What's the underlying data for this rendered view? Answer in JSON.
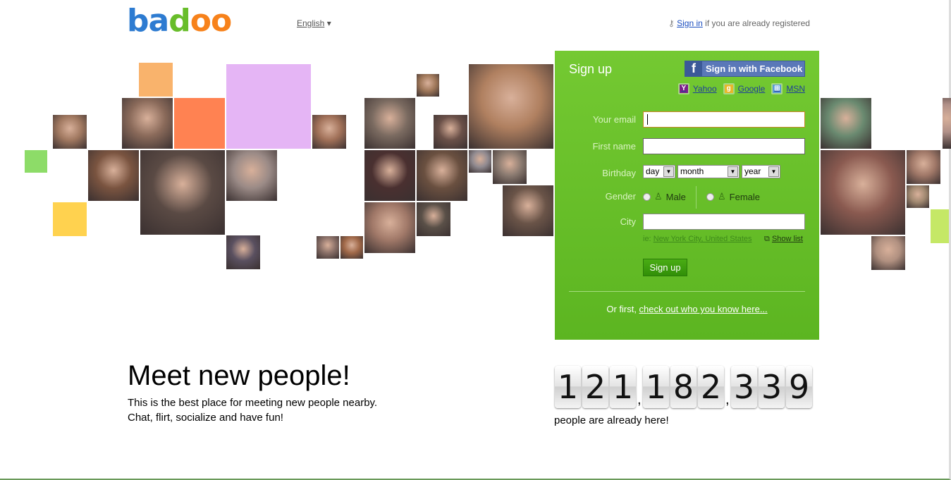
{
  "logo": {
    "b": "b",
    "a": "a",
    "d": "d",
    "o1": "o",
    "o2": "o"
  },
  "header": {
    "language": "English",
    "language_arrow": "▾",
    "signin_link": "Sign in",
    "signin_rest": " if you are already registered",
    "key_icon": "key-icon"
  },
  "signup": {
    "title": "Sign up",
    "facebook": "Sign in with Facebook",
    "providers": [
      {
        "label": "Yahoo",
        "icon": "Y",
        "color": "#7b1f8a"
      },
      {
        "label": "Google",
        "icon": "g",
        "color": "#e9b72a"
      },
      {
        "label": "MSN",
        "icon": "⊞",
        "color": "#5a9ad6"
      }
    ],
    "email_label": "Your email",
    "email_value": "",
    "firstname_label": "First name",
    "firstname_value": "",
    "birthday_label": "Birthday",
    "day": "day",
    "month": "month",
    "year": "year",
    "gender_label": "Gender",
    "male": "Male",
    "female": "Female",
    "city_label": "City",
    "city_value": "",
    "city_hint": "ie:",
    "city_example": "New York City, United States",
    "show_list": "Show list",
    "submit": "Sign up",
    "or_first": "Or first, ",
    "check_out": "check out who you know here..."
  },
  "main": {
    "headline": "Meet new people!",
    "line1": "This is the best place for meeting new people nearby.",
    "line2": "Chat, flirt, socialize and have fun!"
  },
  "counter": {
    "digits": [
      "1",
      "2",
      "1",
      ",",
      "1",
      "8",
      "2",
      ",",
      "3",
      "3",
      "9"
    ],
    "caption": "people are already here!"
  },
  "colors": {
    "panel": "#6cc22a",
    "logo_blue": "#2d7bd1",
    "logo_orange": "#f7821b",
    "logo_green": "#68bd2a"
  }
}
